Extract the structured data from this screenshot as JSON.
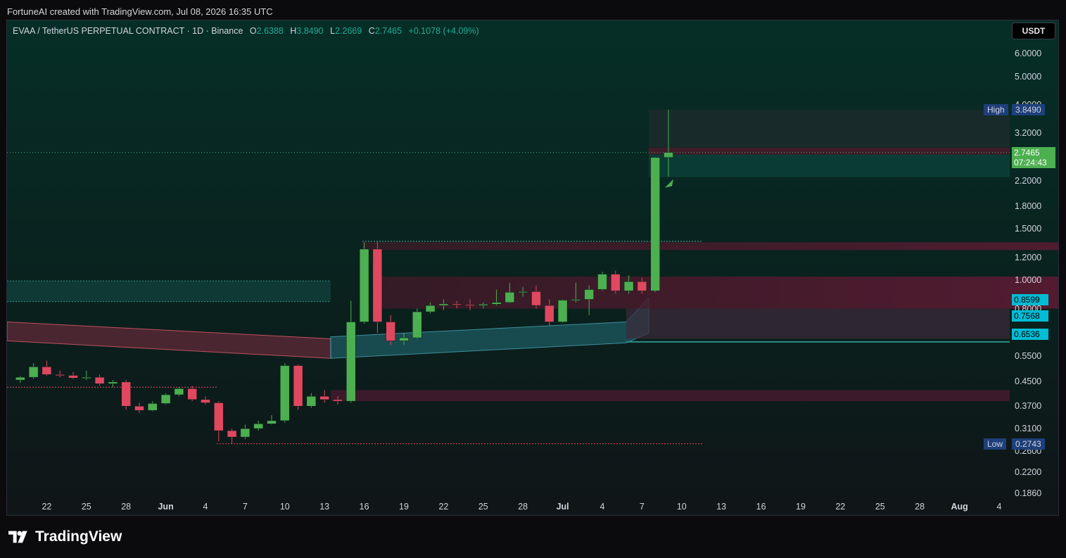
{
  "header": {
    "credit": "FortuneAI created with TradingView.com, Jul 08, 2026 16:35 UTC"
  },
  "legend": {
    "symbol": "EVAA / TetherUS PERPETUAL CONTRACT · 1D · Binance",
    "o_label": "O",
    "o": "2.6388",
    "h_label": "H",
    "h": "3.8490",
    "l_label": "L",
    "l": "2.2669",
    "c_label": "C",
    "c": "2.7465",
    "change": "+0.1078 (+4.09%)"
  },
  "currency_button": "USDT",
  "branding": {
    "name": "TradingView"
  },
  "colors": {
    "up": "#4caf50",
    "down": "#e0485f",
    "accent": "#22ab94",
    "price_tag": "#4caf50",
    "cyan_tag": "#00bcd4",
    "high_low_tag": "#1e3f7a"
  },
  "chart_data": {
    "type": "candlestick",
    "y_scale": "log",
    "ylim": [
      0.18,
      6.5
    ],
    "price_axis_labels": [
      "6.0000",
      "5.0000",
      "4.0000",
      "3.2000",
      "2.2000",
      "1.8000",
      "1.5000",
      "1.2000",
      "1.0000",
      "0.8000",
      "0.5500",
      "0.4500",
      "0.3700",
      "0.3100",
      "0.2600",
      "0.2200",
      "0.1860"
    ],
    "time_axis_labels": [
      {
        "label": "22",
        "bold": false
      },
      {
        "label": "25",
        "bold": false
      },
      {
        "label": "28",
        "bold": false
      },
      {
        "label": "Jun",
        "bold": true
      },
      {
        "label": "4",
        "bold": false
      },
      {
        "label": "7",
        "bold": false
      },
      {
        "label": "10",
        "bold": false
      },
      {
        "label": "13",
        "bold": false
      },
      {
        "label": "16",
        "bold": false
      },
      {
        "label": "19",
        "bold": false
      },
      {
        "label": "22",
        "bold": false
      },
      {
        "label": "25",
        "bold": false
      },
      {
        "label": "28",
        "bold": false
      },
      {
        "label": "Jul",
        "bold": true
      },
      {
        "label": "4",
        "bold": false
      },
      {
        "label": "7",
        "bold": false
      },
      {
        "label": "10",
        "bold": false
      },
      {
        "label": "13",
        "bold": false
      },
      {
        "label": "16",
        "bold": false
      },
      {
        "label": "19",
        "bold": false
      },
      {
        "label": "22",
        "bold": false
      },
      {
        "label": "25",
        "bold": false
      },
      {
        "label": "28",
        "bold": false
      },
      {
        "label": "Aug",
        "bold": true
      },
      {
        "label": "4",
        "bold": false
      }
    ],
    "candles": [
      {
        "date": "2026-05-20",
        "o": 0.455,
        "h": 0.47,
        "l": 0.445,
        "c": 0.465
      },
      {
        "date": "2026-05-21",
        "o": 0.465,
        "h": 0.52,
        "l": 0.46,
        "c": 0.505
      },
      {
        "date": "2026-05-22",
        "o": 0.505,
        "h": 0.53,
        "l": 0.47,
        "c": 0.475
      },
      {
        "date": "2026-05-23",
        "o": 0.475,
        "h": 0.49,
        "l": 0.465,
        "c": 0.472
      },
      {
        "date": "2026-05-24",
        "o": 0.472,
        "h": 0.485,
        "l": 0.458,
        "c": 0.462
      },
      {
        "date": "2026-05-25",
        "o": 0.462,
        "h": 0.49,
        "l": 0.455,
        "c": 0.465
      },
      {
        "date": "2026-05-26",
        "o": 0.465,
        "h": 0.475,
        "l": 0.435,
        "c": 0.442
      },
      {
        "date": "2026-05-27",
        "o": 0.442,
        "h": 0.455,
        "l": 0.43,
        "c": 0.448
      },
      {
        "date": "2026-05-28",
        "o": 0.448,
        "h": 0.455,
        "l": 0.36,
        "c": 0.37
      },
      {
        "date": "2026-05-29",
        "o": 0.37,
        "h": 0.38,
        "l": 0.35,
        "c": 0.358
      },
      {
        "date": "2026-05-30",
        "o": 0.358,
        "h": 0.385,
        "l": 0.355,
        "c": 0.378
      },
      {
        "date": "2026-05-31",
        "o": 0.378,
        "h": 0.41,
        "l": 0.375,
        "c": 0.405
      },
      {
        "date": "2026-06-01",
        "o": 0.405,
        "h": 0.43,
        "l": 0.4,
        "c": 0.425
      },
      {
        "date": "2026-06-02",
        "o": 0.425,
        "h": 0.435,
        "l": 0.385,
        "c": 0.39
      },
      {
        "date": "2026-06-03",
        "o": 0.39,
        "h": 0.4,
        "l": 0.375,
        "c": 0.38
      },
      {
        "date": "2026-06-04",
        "o": 0.38,
        "h": 0.385,
        "l": 0.28,
        "c": 0.305
      },
      {
        "date": "2026-06-05",
        "o": 0.305,
        "h": 0.31,
        "l": 0.275,
        "c": 0.29
      },
      {
        "date": "2026-06-06",
        "o": 0.29,
        "h": 0.32,
        "l": 0.285,
        "c": 0.31
      },
      {
        "date": "2026-06-07",
        "o": 0.31,
        "h": 0.33,
        "l": 0.305,
        "c": 0.322
      },
      {
        "date": "2026-06-08",
        "o": 0.322,
        "h": 0.345,
        "l": 0.32,
        "c": 0.33
      },
      {
        "date": "2026-06-09",
        "o": 0.33,
        "h": 0.52,
        "l": 0.325,
        "c": 0.51
      },
      {
        "date": "2026-06-10",
        "o": 0.51,
        "h": 0.515,
        "l": 0.36,
        "c": 0.37
      },
      {
        "date": "2026-06-11",
        "o": 0.37,
        "h": 0.41,
        "l": 0.365,
        "c": 0.4
      },
      {
        "date": "2026-06-12",
        "o": 0.4,
        "h": 0.42,
        "l": 0.38,
        "c": 0.39
      },
      {
        "date": "2026-06-13",
        "o": 0.39,
        "h": 0.4,
        "l": 0.375,
        "c": 0.385
      },
      {
        "date": "2026-06-14",
        "o": 0.385,
        "h": 0.85,
        "l": 0.38,
        "c": 0.72
      },
      {
        "date": "2026-06-15",
        "o": 0.72,
        "h": 1.35,
        "l": 0.71,
        "c": 1.28
      },
      {
        "date": "2026-06-16",
        "o": 1.28,
        "h": 1.36,
        "l": 0.66,
        "c": 0.72
      },
      {
        "date": "2026-06-17",
        "o": 0.72,
        "h": 0.76,
        "l": 0.6,
        "c": 0.62
      },
      {
        "date": "2026-06-18",
        "o": 0.62,
        "h": 0.66,
        "l": 0.6,
        "c": 0.635
      },
      {
        "date": "2026-06-19",
        "o": 0.635,
        "h": 0.8,
        "l": 0.63,
        "c": 0.78
      },
      {
        "date": "2026-06-20",
        "o": 0.78,
        "h": 0.84,
        "l": 0.77,
        "c": 0.82
      },
      {
        "date": "2026-06-21",
        "o": 0.82,
        "h": 0.86,
        "l": 0.79,
        "c": 0.83
      },
      {
        "date": "2026-06-22",
        "o": 0.83,
        "h": 0.85,
        "l": 0.8,
        "c": 0.825
      },
      {
        "date": "2026-06-23",
        "o": 0.825,
        "h": 0.86,
        "l": 0.79,
        "c": 0.82
      },
      {
        "date": "2026-06-24",
        "o": 0.82,
        "h": 0.84,
        "l": 0.8,
        "c": 0.828
      },
      {
        "date": "2026-06-25",
        "o": 0.828,
        "h": 0.93,
        "l": 0.82,
        "c": 0.84
      },
      {
        "date": "2026-06-26",
        "o": 0.84,
        "h": 0.98,
        "l": 0.835,
        "c": 0.91
      },
      {
        "date": "2026-06-27",
        "o": 0.91,
        "h": 0.95,
        "l": 0.88,
        "c": 0.915
      },
      {
        "date": "2026-06-28",
        "o": 0.915,
        "h": 0.96,
        "l": 0.8,
        "c": 0.82
      },
      {
        "date": "2026-06-29",
        "o": 0.82,
        "h": 0.86,
        "l": 0.7,
        "c": 0.72
      },
      {
        "date": "2026-06-30",
        "o": 0.72,
        "h": 0.86,
        "l": 0.715,
        "c": 0.855
      },
      {
        "date": "2026-07-01",
        "o": 0.855,
        "h": 0.98,
        "l": 0.84,
        "c": 0.86
      },
      {
        "date": "2026-07-02",
        "o": 0.86,
        "h": 0.96,
        "l": 0.76,
        "c": 0.93
      },
      {
        "date": "2026-07-03",
        "o": 0.93,
        "h": 1.07,
        "l": 0.92,
        "c": 1.05
      },
      {
        "date": "2026-07-04",
        "o": 1.05,
        "h": 1.08,
        "l": 0.9,
        "c": 0.92
      },
      {
        "date": "2026-07-05",
        "o": 0.92,
        "h": 1.04,
        "l": 0.9,
        "c": 0.99
      },
      {
        "date": "2026-07-06",
        "o": 0.99,
        "h": 1.02,
        "l": 0.9,
        "c": 0.92
      },
      {
        "date": "2026-07-07",
        "o": 0.92,
        "h": 2.65,
        "l": 0.91,
        "c": 2.6388
      },
      {
        "date": "2026-07-08",
        "o": 2.6388,
        "h": 3.849,
        "l": 2.2669,
        "c": 2.7465
      }
    ],
    "price_tags": [
      {
        "label": "High",
        "value": "3.8490",
        "kind": "high"
      },
      {
        "value": "2.7465",
        "countdown": "07:24:43",
        "kind": "last"
      },
      {
        "value": "0.8599",
        "kind": "cyan"
      },
      {
        "value": "0.7568",
        "kind": "cyan"
      },
      {
        "value": "0.6536",
        "kind": "cyan"
      },
      {
        "label": "Low",
        "value": "0.2743",
        "kind": "low"
      }
    ]
  }
}
